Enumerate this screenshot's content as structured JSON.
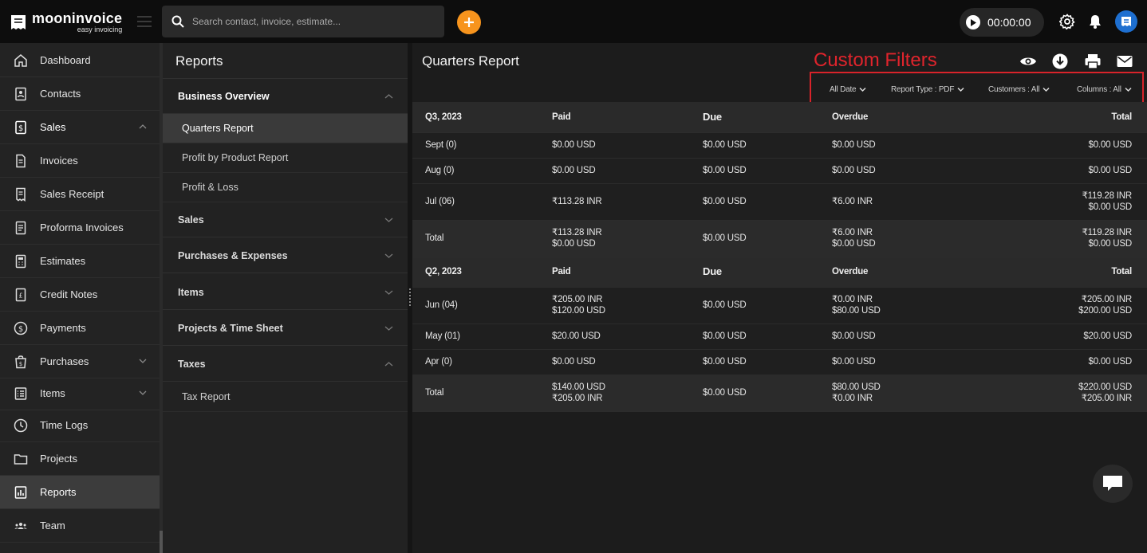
{
  "app": {
    "name": "mooninvoice",
    "tagline": "easy invoicing"
  },
  "topbar": {
    "search_placeholder": "Search contact, invoice, estimate...",
    "timer": "00:00:00"
  },
  "sidebar": {
    "items": [
      {
        "label": "Dashboard"
      },
      {
        "label": "Contacts"
      },
      {
        "label": "Sales"
      },
      {
        "label": "Invoices"
      },
      {
        "label": "Sales Receipt"
      },
      {
        "label": "Proforma Invoices"
      },
      {
        "label": "Estimates"
      },
      {
        "label": "Credit Notes"
      },
      {
        "label": "Payments"
      },
      {
        "label": "Purchases"
      },
      {
        "label": "Items"
      },
      {
        "label": "Time Logs"
      },
      {
        "label": "Projects"
      },
      {
        "label": "Reports"
      },
      {
        "label": "Team"
      }
    ]
  },
  "reports_menu": {
    "title": "Reports",
    "groups": {
      "business_overview": "Business Overview",
      "sales": "Sales",
      "purchases": "Purchases & Expenses",
      "items": "Items",
      "projects": "Projects & Time Sheet",
      "taxes": "Taxes"
    },
    "items": {
      "quarters": "Quarters Report",
      "profit_product": "Profit by Product Report",
      "profit_loss": "Profit & Loss",
      "tax_report": "Tax Report"
    }
  },
  "main": {
    "title": "Quarters Report",
    "annotation": "Custom Filters",
    "filters": {
      "date": "All Date",
      "report_type": "Report Type : PDF",
      "customers": "Customers : All",
      "columns": "Columns : All"
    },
    "columns": {
      "paid": "Paid",
      "due": "Due",
      "overdue": "Overdue",
      "total": "Total"
    },
    "q3": {
      "label": "Q3, 2023",
      "rows": [
        {
          "month": "Sept (0)",
          "paid1": "$0.00 USD",
          "paid2": "",
          "due": "$0.00 USD",
          "over1": "$0.00 USD",
          "over2": "",
          "total1": "$0.00 USD",
          "total2": ""
        },
        {
          "month": "Aug (0)",
          "paid1": "$0.00 USD",
          "paid2": "",
          "due": "$0.00 USD",
          "over1": "$0.00 USD",
          "over2": "",
          "total1": "$0.00 USD",
          "total2": ""
        },
        {
          "month": "Jul (06)",
          "paid1": "₹113.28 INR",
          "paid2": "",
          "due": "$0.00 USD",
          "over1": "₹6.00 INR",
          "over2": "",
          "total1": "₹119.28 INR",
          "total2": "$0.00 USD"
        }
      ],
      "total": {
        "label": "Total",
        "paid1": "₹113.28 INR",
        "paid2": "$0.00 USD",
        "due": "$0.00 USD",
        "over1": "₹6.00 INR",
        "over2": "$0.00 USD",
        "total1": "₹119.28 INR",
        "total2": "$0.00 USD"
      }
    },
    "q2": {
      "label": "Q2, 2023",
      "rows": [
        {
          "month": "Jun (04)",
          "paid1": "₹205.00 INR",
          "paid2": "$120.00 USD",
          "due": "$0.00 USD",
          "over1": "₹0.00 INR",
          "over2": "$80.00 USD",
          "total1": "₹205.00 INR",
          "total2": "$200.00 USD"
        },
        {
          "month": "May (01)",
          "paid1": "$20.00 USD",
          "paid2": "",
          "due": "$0.00 USD",
          "over1": "$0.00 USD",
          "over2": "",
          "total1": "$20.00 USD",
          "total2": ""
        },
        {
          "month": "Apr (0)",
          "paid1": "$0.00 USD",
          "paid2": "",
          "due": "$0.00 USD",
          "over1": "$0.00 USD",
          "over2": "",
          "total1": "$0.00 USD",
          "total2": ""
        }
      ],
      "total": {
        "label": "Total",
        "paid1": "$140.00 USD",
        "paid2": "₹205.00 INR",
        "due": "$0.00 USD",
        "over1": "$80.00 USD",
        "over2": "₹0.00 INR",
        "total1": "$220.00 USD",
        "total2": "₹205.00 INR"
      }
    }
  },
  "colors": {
    "accent": "#f7941d",
    "annotation": "#e0242c",
    "avatar": "#1e6fd0"
  }
}
